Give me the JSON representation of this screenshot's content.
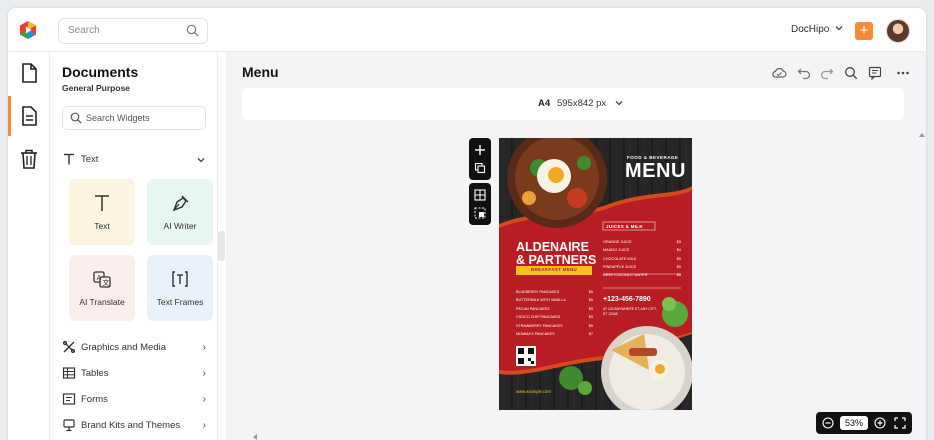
{
  "topbar": {
    "search_placeholder": "Search",
    "brand_label": "DocHipo",
    "add_label": "+"
  },
  "rail": {
    "items": [
      {
        "icon": "document-icon"
      },
      {
        "icon": "widgets-icon",
        "active": true
      },
      {
        "icon": "trash-icon"
      }
    ]
  },
  "panel": {
    "title": "Documents",
    "subtitle": "General Purpose",
    "search_placeholder": "Search Widgets",
    "text_section": "Text",
    "cards": [
      {
        "label": "Text",
        "icon": "text-t-icon",
        "bg": "#fdf3e1"
      },
      {
        "label": "AI Writer",
        "icon": "pen-nib-icon",
        "bg": "#e6f6f3"
      },
      {
        "label": "AI Translate",
        "icon": "translate-icon",
        "bg": "#fdeeee"
      },
      {
        "label": "Text Frames",
        "icon": "text-frame-icon",
        "bg": "#e9f1fb"
      }
    ],
    "sections": [
      {
        "label": "Graphics and Media",
        "icon": "graphics-icon"
      },
      {
        "label": "Tables",
        "icon": "table-icon"
      },
      {
        "label": "Forms",
        "icon": "form-icon"
      },
      {
        "label": "Brand Kits and Themes",
        "icon": "brand-kit-icon"
      }
    ]
  },
  "main": {
    "title": "Menu",
    "size_prefix": "A4",
    "size_value": "595x842 px",
    "zoom": "53%"
  },
  "poster": {
    "tagline": "FOOD & BEVERAGE",
    "menu_word": "MENU",
    "juices_title": "JUICES & MILK",
    "juices": [
      {
        "name": "ORANGE JUICE",
        "price": "$3"
      },
      {
        "name": "MANGO JUICE",
        "price": "$4"
      },
      {
        "name": "CHOCOLATE MILK",
        "price": "$5"
      },
      {
        "name": "PINEAPPLE JUICE",
        "price": "$5"
      },
      {
        "name": "NEW! COCONUT WATER",
        "price": "$6"
      }
    ],
    "brand_line1": "ALDENAIRE",
    "brand_line2": "& PARTNERS",
    "breakfast_title": "BREAKFAST MENU",
    "breakfast": [
      {
        "name": "BLUEBERRY PANCAKES",
        "price": "$5"
      },
      {
        "name": "BUTTERMILK WITH VANILLA",
        "price": "$5"
      },
      {
        "name": "PECAN PANCAKES",
        "price": "$5"
      },
      {
        "name": "CHOCO CHIP PANCAKES",
        "price": "$5"
      },
      {
        "name": "STRAWBERRY PANCAKES",
        "price": "$5"
      },
      {
        "name": "MOMMA'S PANCAKES",
        "price": "$7"
      }
    ],
    "phone": "+123-456-7890",
    "address": "AT 123 ANYWHERE ST, ANY CITY, ST 12345",
    "website": "www.example.com"
  }
}
